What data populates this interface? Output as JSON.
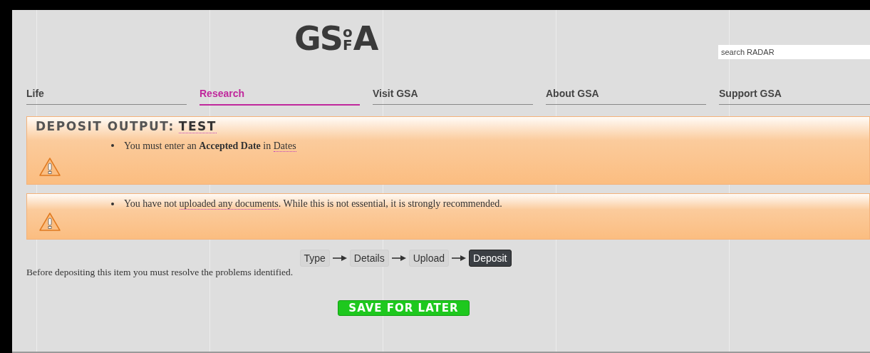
{
  "logo": {
    "left": "GS",
    "top": "o",
    "bottom": "F",
    "right": "A"
  },
  "search": {
    "placeholder": "search RADAR"
  },
  "nav": [
    {
      "label": "Life",
      "selected": false
    },
    {
      "label": "Research",
      "selected": true
    },
    {
      "label": "Visit GSA",
      "selected": false
    },
    {
      "label": "About GSA",
      "selected": false
    },
    {
      "label": "Support GSA",
      "selected": false
    }
  ],
  "heading": {
    "label": "DEPOSIT OUTPUT:",
    "value": "TEST"
  },
  "warnings": [
    {
      "parts": [
        {
          "kind": "plain",
          "text": "You must enter an "
        },
        {
          "kind": "bold",
          "text": "Accepted Date"
        },
        {
          "kind": "plain",
          "text": " in "
        },
        {
          "kind": "link",
          "text": "Dates"
        }
      ]
    },
    {
      "parts": [
        {
          "kind": "plain",
          "text": "You have not "
        },
        {
          "kind": "link",
          "text": "uploaded any documents"
        },
        {
          "kind": "plain",
          "text": ". While this is not essential, it is strongly recommended."
        }
      ]
    }
  ],
  "steps": [
    {
      "label": "Type",
      "selected": false
    },
    {
      "label": "Details",
      "selected": false
    },
    {
      "label": "Upload",
      "selected": false
    },
    {
      "label": "Deposit",
      "selected": true
    }
  ],
  "message": "Before depositing this item you must resolve the problems identified.",
  "save_button": "SAVE FOR LATER"
}
